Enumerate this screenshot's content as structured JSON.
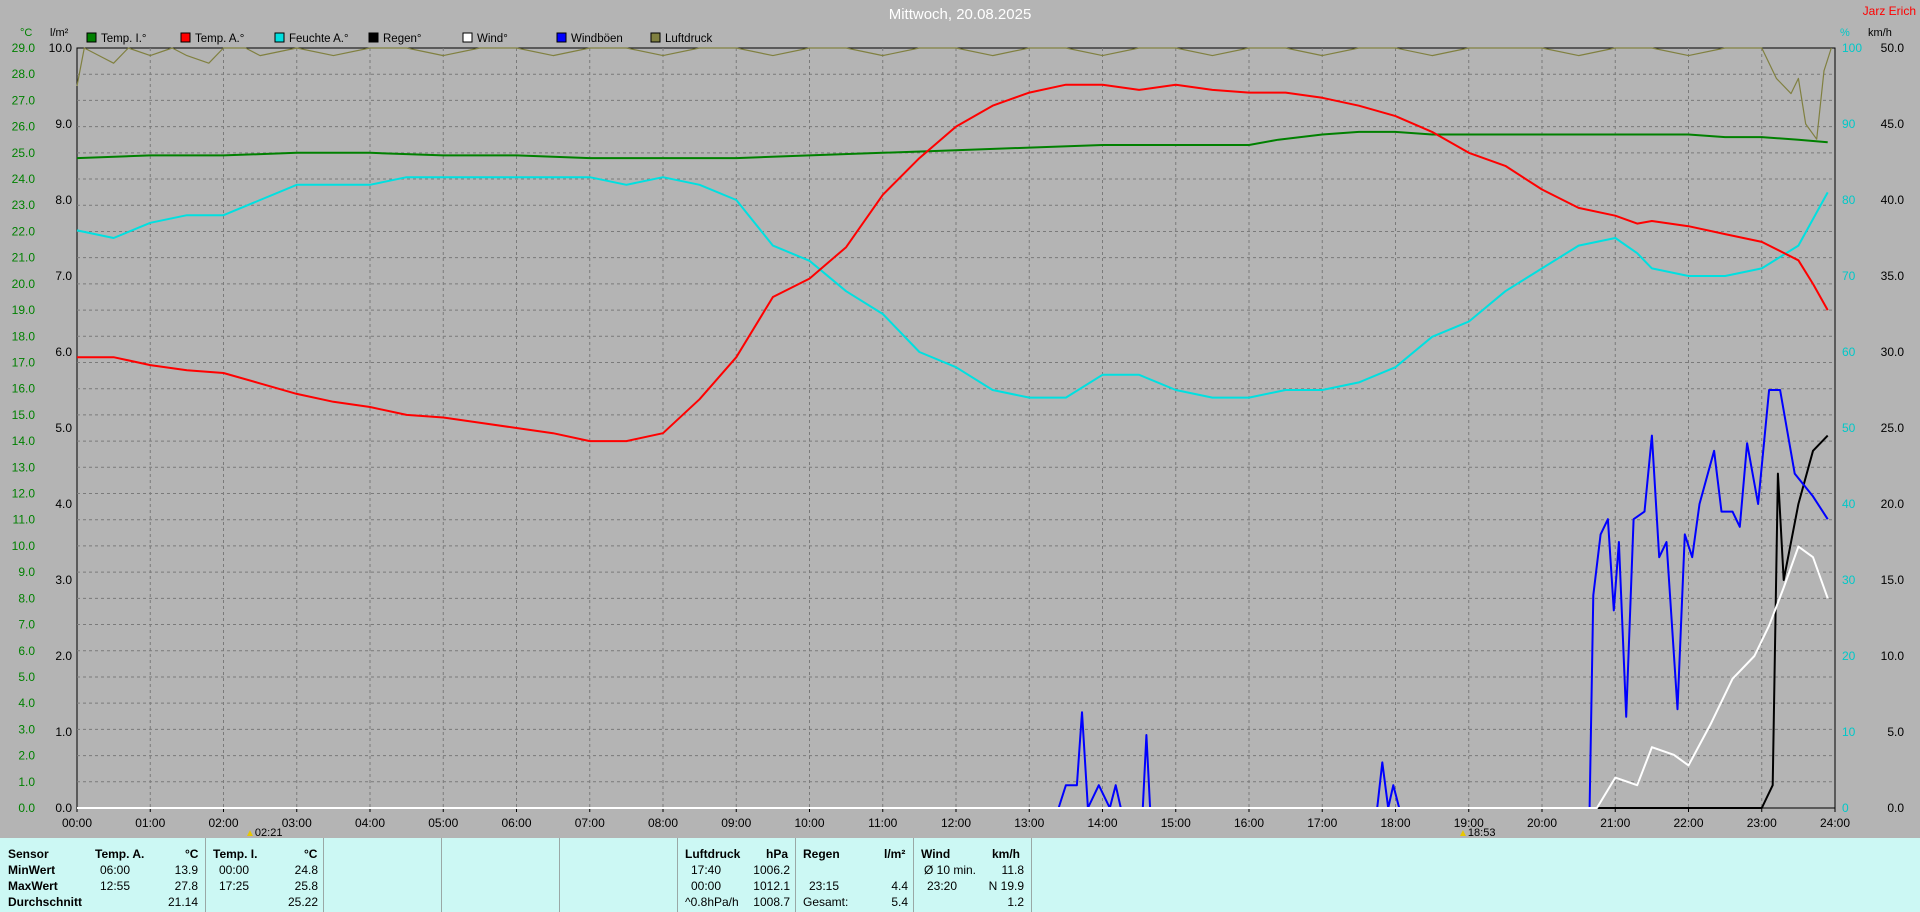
{
  "title": "Mittwoch, 20.08.2025",
  "brand": "Jarz Erich",
  "left_axis_units": {
    "temp": "°C",
    "rain": "l/m²"
  },
  "right_axis_units": {
    "pct": "%",
    "wind": "km/h"
  },
  "legend": [
    {
      "label": "Temp. I.°",
      "color": "#008000"
    },
    {
      "label": "Temp. A.°",
      "color": "#ff0000"
    },
    {
      "label": "Feuchte A.°",
      "color": "#00e0e0"
    },
    {
      "label": "Regen°",
      "color": "#000000"
    },
    {
      "label": "Wind°",
      "color": "#ffffff"
    },
    {
      "label": "Windböen",
      "color": "#0000ff"
    },
    {
      "label": "Luftdruck",
      "color": "#808040"
    }
  ],
  "markers": [
    {
      "label": "02:21"
    },
    {
      "label": "18:53"
    }
  ],
  "chart_data": {
    "type": "line",
    "title": "Mittwoch, 20.08.2025",
    "x_range_h": [
      0,
      24
    ],
    "x_ticks": [
      "00:00",
      "01:00",
      "02:00",
      "03:00",
      "04:00",
      "05:00",
      "06:00",
      "07:00",
      "08:00",
      "09:00",
      "10:00",
      "11:00",
      "12:00",
      "13:00",
      "14:00",
      "15:00",
      "16:00",
      "17:00",
      "18:00",
      "19:00",
      "20:00",
      "21:00",
      "22:00",
      "23:00",
      "24:00"
    ],
    "temp_axis": {
      "range": [
        0,
        29
      ],
      "ticks": [
        "0.0",
        "1.0",
        "2.0",
        "3.0",
        "4.0",
        "5.0",
        "6.0",
        "7.0",
        "8.0",
        "9.0",
        "10.0",
        "11.0",
        "12.0",
        "13.0",
        "14.0",
        "15.0",
        "16.0",
        "17.0",
        "18.0",
        "19.0",
        "20.0",
        "21.0",
        "22.0",
        "23.0",
        "24.0",
        "25.0",
        "26.0",
        "27.0",
        "28.0",
        "29.0"
      ]
    },
    "rain_axis": {
      "range": [
        0,
        10
      ],
      "ticks": [
        "0.0",
        "1.0",
        "2.0",
        "3.0",
        "4.0",
        "5.0",
        "6.0",
        "7.0",
        "8.0",
        "9.0",
        "10.0"
      ]
    },
    "pct_axis": {
      "range": [
        0,
        100
      ],
      "ticks": [
        "0",
        "10",
        "20",
        "30",
        "40",
        "50",
        "60",
        "70",
        "80",
        "90",
        "100"
      ]
    },
    "wind_axis": {
      "range": [
        0,
        50
      ],
      "ticks": [
        "0.0",
        "5.0",
        "10.0",
        "15.0",
        "20.0",
        "25.0",
        "30.0",
        "35.0",
        "40.0",
        "45.0",
        "50.0"
      ]
    },
    "grid": true,
    "series": [
      {
        "name": "Temp. I.°",
        "color": "#008000",
        "axis": "temp",
        "points": [
          [
            0,
            24.8
          ],
          [
            1,
            24.9
          ],
          [
            2,
            24.9
          ],
          [
            3,
            25.0
          ],
          [
            4,
            25.0
          ],
          [
            5,
            24.9
          ],
          [
            6,
            24.9
          ],
          [
            7,
            24.8
          ],
          [
            8,
            24.8
          ],
          [
            9,
            24.8
          ],
          [
            10,
            24.9
          ],
          [
            11,
            25.0
          ],
          [
            12,
            25.1
          ],
          [
            13,
            25.2
          ],
          [
            14,
            25.3
          ],
          [
            15,
            25.3
          ],
          [
            16,
            25.3
          ],
          [
            16.4,
            25.5
          ],
          [
            17,
            25.7
          ],
          [
            17.5,
            25.8
          ],
          [
            18,
            25.8
          ],
          [
            18.5,
            25.7
          ],
          [
            19,
            25.7
          ],
          [
            20,
            25.7
          ],
          [
            21,
            25.7
          ],
          [
            22,
            25.7
          ],
          [
            22.5,
            25.6
          ],
          [
            23,
            25.6
          ],
          [
            23.5,
            25.5
          ],
          [
            23.9,
            25.4
          ]
        ]
      },
      {
        "name": "Temp. A.°",
        "color": "#ff0000",
        "axis": "temp",
        "points": [
          [
            0,
            17.2
          ],
          [
            0.3,
            17.2
          ],
          [
            0.5,
            17.2
          ],
          [
            1,
            16.9
          ],
          [
            1.5,
            16.7
          ],
          [
            2,
            16.6
          ],
          [
            2.5,
            16.2
          ],
          [
            3,
            15.8
          ],
          [
            3.5,
            15.5
          ],
          [
            4,
            15.3
          ],
          [
            4.5,
            15.0
          ],
          [
            5,
            14.9
          ],
          [
            5.5,
            14.7
          ],
          [
            6,
            14.5
          ],
          [
            6.5,
            14.3
          ],
          [
            7,
            14.0
          ],
          [
            7.5,
            14.0
          ],
          [
            8,
            14.3
          ],
          [
            8.5,
            15.6
          ],
          [
            9,
            17.2
          ],
          [
            9.5,
            19.5
          ],
          [
            10,
            20.2
          ],
          [
            10.5,
            21.4
          ],
          [
            11,
            23.4
          ],
          [
            11.5,
            24.8
          ],
          [
            12,
            26.0
          ],
          [
            12.5,
            26.8
          ],
          [
            13,
            27.3
          ],
          [
            13.5,
            27.6
          ],
          [
            14,
            27.6
          ],
          [
            14.5,
            27.4
          ],
          [
            15,
            27.6
          ],
          [
            15.5,
            27.4
          ],
          [
            16,
            27.3
          ],
          [
            16.5,
            27.3
          ],
          [
            17,
            27.1
          ],
          [
            17.5,
            26.8
          ],
          [
            18,
            26.4
          ],
          [
            18.5,
            25.8
          ],
          [
            19,
            25.0
          ],
          [
            19.5,
            24.5
          ],
          [
            20,
            23.6
          ],
          [
            20.5,
            22.9
          ],
          [
            21,
            22.6
          ],
          [
            21.3,
            22.3
          ],
          [
            21.5,
            22.4
          ],
          [
            22,
            22.2
          ],
          [
            22.5,
            21.9
          ],
          [
            23,
            21.6
          ],
          [
            23.5,
            20.9
          ],
          [
            23.7,
            20.0
          ],
          [
            23.9,
            19.0
          ]
        ]
      },
      {
        "name": "Feuchte A.°",
        "color": "#00e0e0",
        "axis": "pct",
        "points": [
          [
            0,
            76
          ],
          [
            0.5,
            75
          ],
          [
            1,
            77
          ],
          [
            1.5,
            78
          ],
          [
            2,
            78
          ],
          [
            2.5,
            80
          ],
          [
            3,
            82
          ],
          [
            3.5,
            82
          ],
          [
            4,
            82
          ],
          [
            4.5,
            83
          ],
          [
            5,
            83
          ],
          [
            5.5,
            83
          ],
          [
            6,
            83
          ],
          [
            6.5,
            83
          ],
          [
            7,
            83
          ],
          [
            7.5,
            82
          ],
          [
            8,
            83
          ],
          [
            8.5,
            82
          ],
          [
            9,
            80
          ],
          [
            9.5,
            74
          ],
          [
            10,
            72
          ],
          [
            10.5,
            68
          ],
          [
            11,
            65
          ],
          [
            11.5,
            60
          ],
          [
            12,
            58
          ],
          [
            12.5,
            55
          ],
          [
            13,
            54
          ],
          [
            13.5,
            54
          ],
          [
            14,
            57
          ],
          [
            14.5,
            57
          ],
          [
            15,
            55
          ],
          [
            15.5,
            54
          ],
          [
            16,
            54
          ],
          [
            16.5,
            55
          ],
          [
            17,
            55
          ],
          [
            17.5,
            56
          ],
          [
            18,
            58
          ],
          [
            18.5,
            62
          ],
          [
            19,
            64
          ],
          [
            19.5,
            68
          ],
          [
            20,
            71
          ],
          [
            20.5,
            74
          ],
          [
            21,
            75
          ],
          [
            21.3,
            73
          ],
          [
            21.5,
            71
          ],
          [
            22,
            70
          ],
          [
            22.5,
            70
          ],
          [
            23,
            71
          ],
          [
            23.5,
            74
          ],
          [
            23.9,
            81
          ]
        ]
      },
      {
        "name": "Regen°",
        "color": "#000000",
        "axis": "rain",
        "points": [
          [
            0,
            0
          ],
          [
            23.0,
            0
          ],
          [
            23.15,
            0.3
          ],
          [
            23.22,
            4.4
          ],
          [
            23.3,
            3.0
          ],
          [
            23.5,
            4.0
          ],
          [
            23.7,
            4.7
          ],
          [
            23.9,
            4.9
          ]
        ]
      },
      {
        "name": "Wind°",
        "color": "#ffffff",
        "axis": "wind",
        "points": [
          [
            0,
            0
          ],
          [
            20.75,
            0
          ],
          [
            21.0,
            2.0
          ],
          [
            21.3,
            1.5
          ],
          [
            21.5,
            4.0
          ],
          [
            21.8,
            3.5
          ],
          [
            22.0,
            2.8
          ],
          [
            22.3,
            5.5
          ],
          [
            22.6,
            8.5
          ],
          [
            22.9,
            10.0
          ],
          [
            23.1,
            12.0
          ],
          [
            23.3,
            14.5
          ],
          [
            23.5,
            17.2
          ],
          [
            23.7,
            16.5
          ],
          [
            23.9,
            13.8
          ]
        ]
      },
      {
        "name": "Windböen",
        "color": "#0000ff",
        "axis": "wind",
        "points": [
          [
            0,
            0
          ],
          [
            13.4,
            0
          ],
          [
            13.5,
            1.5
          ],
          [
            13.65,
            1.5
          ],
          [
            13.72,
            6.3
          ],
          [
            13.8,
            0
          ],
          [
            13.95,
            1.5
          ],
          [
            14.1,
            0
          ],
          [
            14.18,
            1.5
          ],
          [
            14.25,
            0
          ],
          [
            14.55,
            0
          ],
          [
            14.6,
            4.8
          ],
          [
            14.65,
            0
          ],
          [
            17.75,
            0
          ],
          [
            17.82,
            3.0
          ],
          [
            17.9,
            0
          ],
          [
            17.97,
            1.5
          ],
          [
            18.05,
            0
          ],
          [
            20.65,
            0
          ],
          [
            20.7,
            14.0
          ],
          [
            20.8,
            18.0
          ],
          [
            20.9,
            19.0
          ],
          [
            20.98,
            13.0
          ],
          [
            21.05,
            17.5
          ],
          [
            21.15,
            6.0
          ],
          [
            21.25,
            19.0
          ],
          [
            21.4,
            19.5
          ],
          [
            21.5,
            24.5
          ],
          [
            21.6,
            16.5
          ],
          [
            21.7,
            17.5
          ],
          [
            21.85,
            6.5
          ],
          [
            21.95,
            18.0
          ],
          [
            22.05,
            16.5
          ],
          [
            22.15,
            20.0
          ],
          [
            22.35,
            23.5
          ],
          [
            22.45,
            19.5
          ],
          [
            22.6,
            19.5
          ],
          [
            22.7,
            18.5
          ],
          [
            22.8,
            24.0
          ],
          [
            22.95,
            20.0
          ],
          [
            23.1,
            27.5
          ],
          [
            23.25,
            27.5
          ],
          [
            23.45,
            22.0
          ],
          [
            23.7,
            20.5
          ],
          [
            23.9,
            19.0
          ]
        ]
      },
      {
        "name": "Luftdruck",
        "color": "#808040",
        "axis": "pct",
        "points": [
          [
            0,
            95
          ],
          [
            0.1,
            100
          ],
          [
            0.3,
            99
          ],
          [
            0.5,
            98
          ],
          [
            0.7,
            100
          ],
          [
            1,
            99
          ],
          [
            1.3,
            100
          ],
          [
            1.5,
            99
          ],
          [
            1.8,
            98
          ],
          [
            2,
            100
          ],
          [
            2.3,
            100
          ],
          [
            2.5,
            99
          ],
          [
            3,
            100
          ],
          [
            3.5,
            99
          ],
          [
            4,
            100
          ],
          [
            4.5,
            100
          ],
          [
            5,
            99
          ],
          [
            5.5,
            100
          ],
          [
            6,
            100
          ],
          [
            6.5,
            99
          ],
          [
            7,
            100
          ],
          [
            7.5,
            100
          ],
          [
            8,
            99
          ],
          [
            8.5,
            100
          ],
          [
            9,
            100
          ],
          [
            9.5,
            99
          ],
          [
            10,
            100
          ],
          [
            10.5,
            100
          ],
          [
            11,
            99
          ],
          [
            11.5,
            100
          ],
          [
            12,
            100
          ],
          [
            12.5,
            99
          ],
          [
            13,
            100
          ],
          [
            13.5,
            100
          ],
          [
            14,
            99
          ],
          [
            14.5,
            100
          ],
          [
            15,
            100
          ],
          [
            15.5,
            99
          ],
          [
            16,
            100
          ],
          [
            16.5,
            100
          ],
          [
            17,
            99
          ],
          [
            17.5,
            100
          ],
          [
            18,
            100
          ],
          [
            18.5,
            99
          ],
          [
            19,
            100
          ],
          [
            19.5,
            100
          ],
          [
            20,
            100
          ],
          [
            20.5,
            99
          ],
          [
            21,
            100
          ],
          [
            21.5,
            100
          ],
          [
            22,
            99
          ],
          [
            22.5,
            100
          ],
          [
            23,
            100
          ],
          [
            23.2,
            96
          ],
          [
            23.4,
            94
          ],
          [
            23.5,
            96
          ],
          [
            23.6,
            90
          ],
          [
            23.75,
            88
          ],
          [
            23.85,
            97
          ],
          [
            23.95,
            100
          ]
        ]
      }
    ]
  },
  "stats": {
    "temp_a": {
      "sensor_label": "Sensor",
      "title": "Temp. A.",
      "unit": "°C",
      "row_labels": [
        "MinWert",
        "MaxWert",
        "Durchschnitt"
      ],
      "times": [
        "06:00",
        "12:55",
        ""
      ],
      "values": [
        "13.9",
        "27.8",
        "21.14"
      ]
    },
    "temp_i": {
      "title": "Temp. I.",
      "unit": "°C",
      "times": [
        "00:00",
        "17:25",
        ""
      ],
      "values": [
        "24.8",
        "25.8",
        "25.22"
      ]
    },
    "luftdruck": {
      "title": "Luftdruck",
      "unit": "hPa",
      "times": [
        "17:40",
        "00:00",
        "^0.8hPa/h"
      ],
      "values": [
        "1006.2",
        "1012.1",
        "1008.7"
      ]
    },
    "regen": {
      "title": "Regen",
      "unit": "l/m²",
      "times": [
        "",
        "23:15",
        "Gesamt:"
      ],
      "values": [
        "",
        "4.4",
        "5.4"
      ]
    },
    "wind": {
      "title": "Wind",
      "unit": "km/h",
      "times": [
        "Ø 10 min.",
        "23:20",
        ""
      ],
      "values": [
        "11.8",
        "N 19.9",
        "1.2"
      ]
    }
  }
}
